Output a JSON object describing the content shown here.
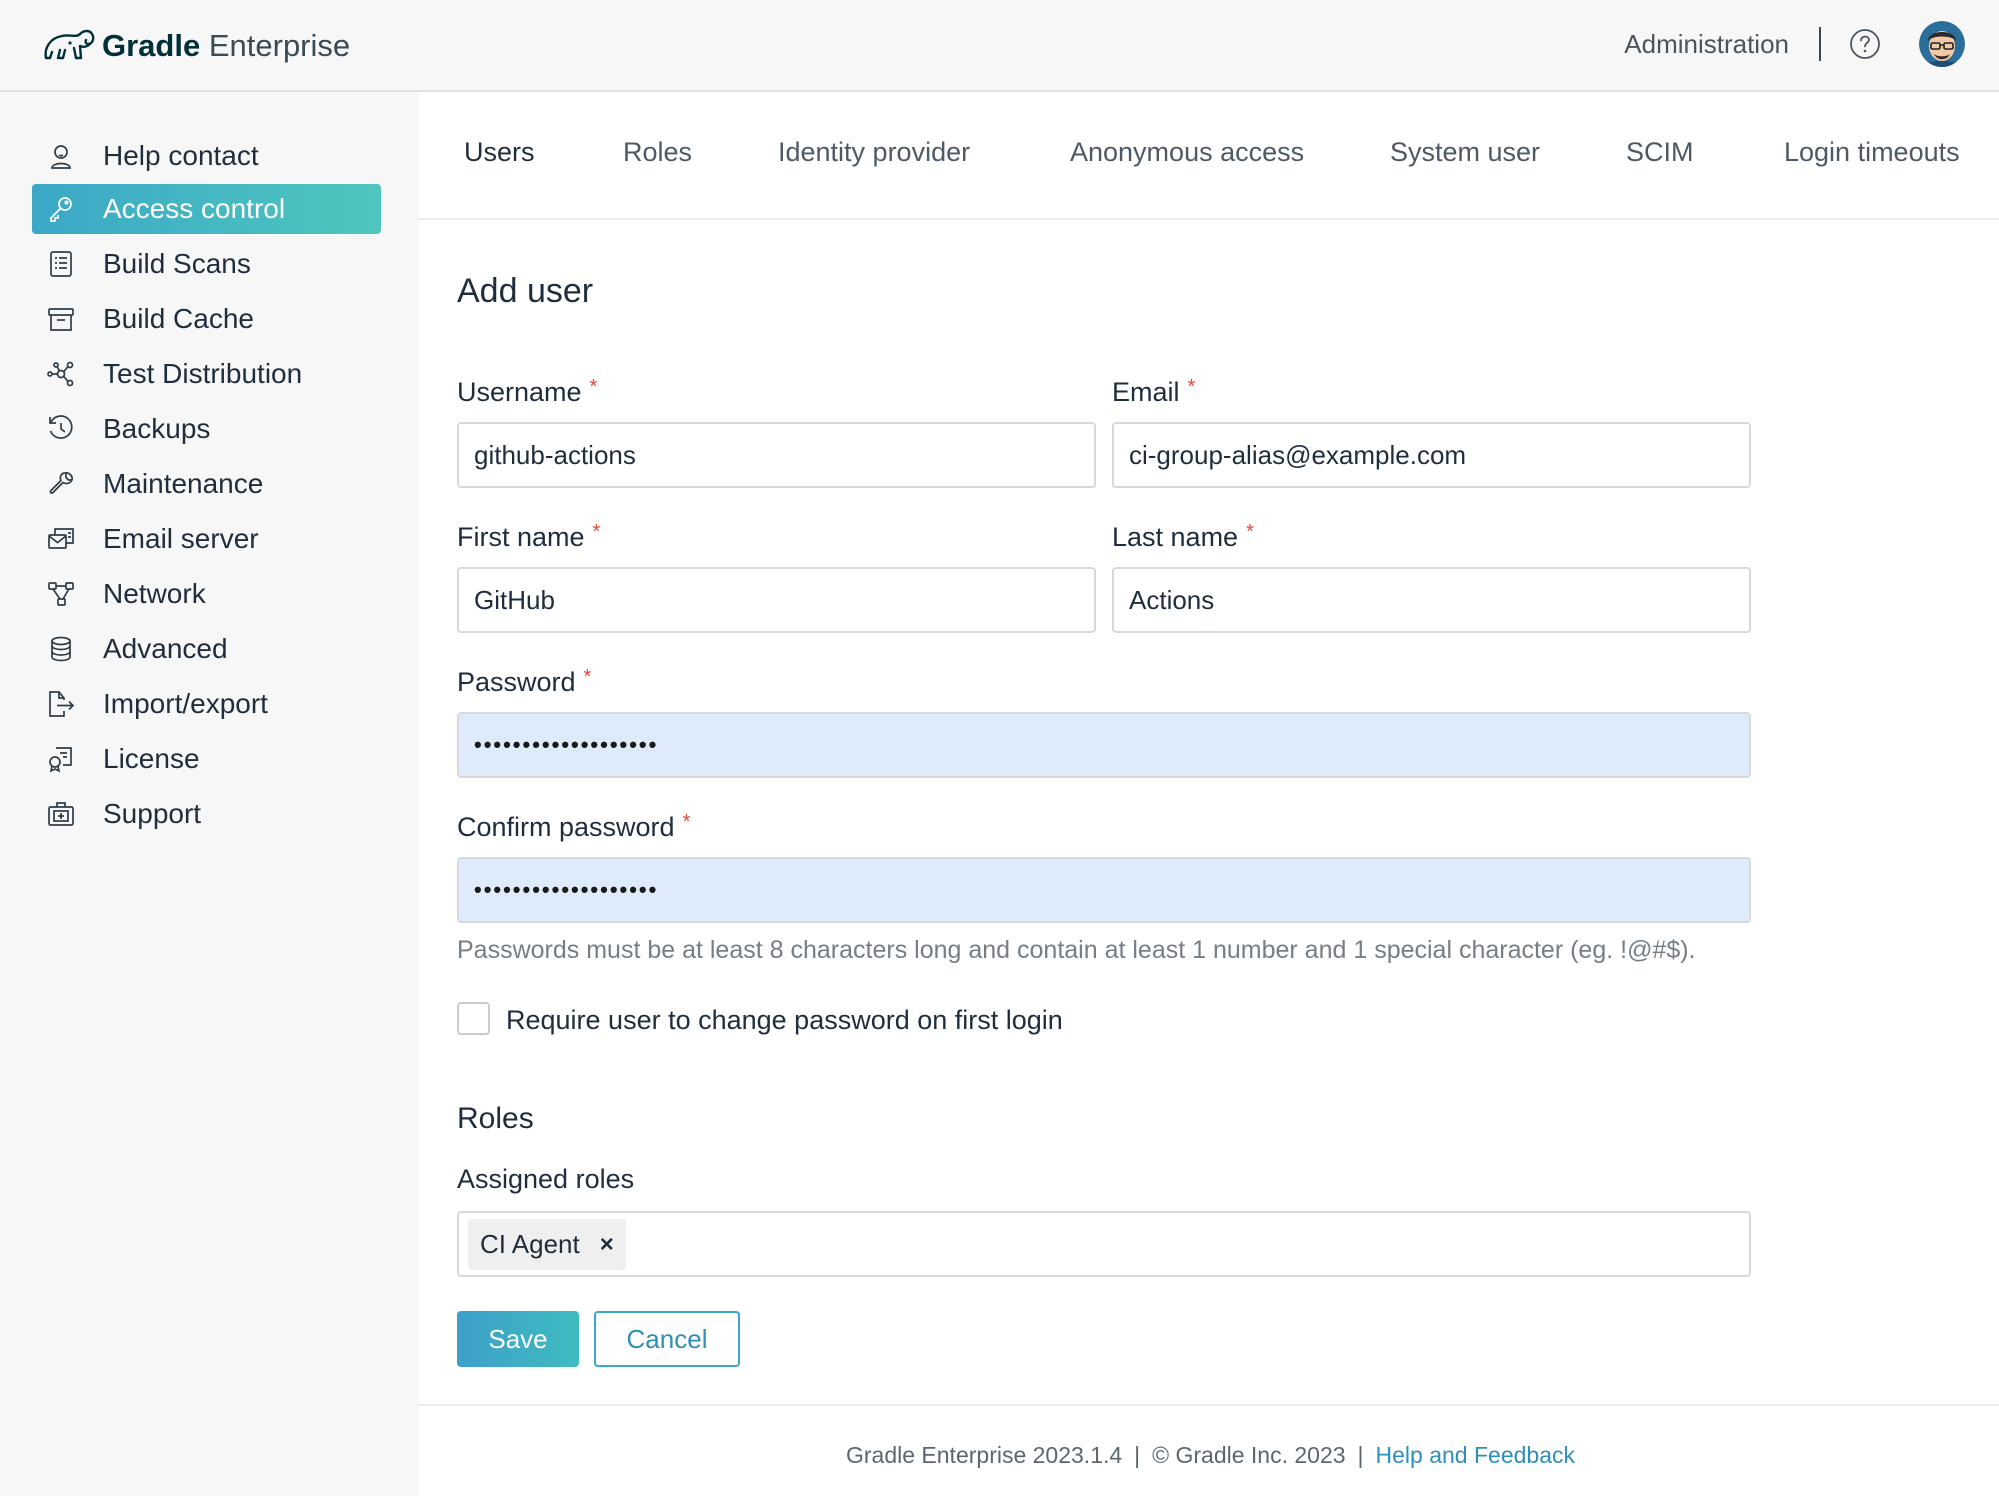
{
  "header": {
    "brand_bold": "Gradle",
    "brand_light": "Enterprise",
    "admin_label": "Administration",
    "help_icon": "question-circle-icon"
  },
  "sidebar": {
    "items": [
      {
        "label": "Help contact",
        "icon": "person-icon"
      },
      {
        "label": "Access control",
        "icon": "key-icon",
        "active": true
      },
      {
        "label": "Build Scans",
        "icon": "list-icon"
      },
      {
        "label": "Build Cache",
        "icon": "archive-icon"
      },
      {
        "label": "Test Distribution",
        "icon": "distribution-icon"
      },
      {
        "label": "Backups",
        "icon": "history-icon"
      },
      {
        "label": "Maintenance",
        "icon": "wrench-icon"
      },
      {
        "label": "Email server",
        "icon": "email-server-icon"
      },
      {
        "label": "Network",
        "icon": "network-icon"
      },
      {
        "label": "Advanced",
        "icon": "database-icon"
      },
      {
        "label": "Import/export",
        "icon": "export-icon"
      },
      {
        "label": "License",
        "icon": "license-icon"
      },
      {
        "label": "Support",
        "icon": "support-icon"
      }
    ]
  },
  "tabs": [
    {
      "label": "Users",
      "active": true
    },
    {
      "label": "Roles"
    },
    {
      "label": "Identity provider"
    },
    {
      "label": "Anonymous access"
    },
    {
      "label": "System user"
    },
    {
      "label": "SCIM"
    },
    {
      "label": "Login timeouts"
    }
  ],
  "form": {
    "title": "Add user",
    "username": {
      "label": "Username",
      "value": "github-actions"
    },
    "email": {
      "label": "Email",
      "value": "ci-group-alias@example.com"
    },
    "first_name": {
      "label": "First name",
      "value": "GitHub"
    },
    "last_name": {
      "label": "Last name",
      "value": "Actions"
    },
    "password": {
      "label": "Password",
      "masked": "•••••••••••••••••••"
    },
    "confirm_password": {
      "label": "Confirm password",
      "masked": "•••••••••••••••••••"
    },
    "password_hint": "Passwords must be at least 8 characters long and contain at least 1 number and 1 special character (eg. !@#$).",
    "require_change_label": "Require user to change password on first login",
    "require_change_checked": false,
    "required_marker": "*"
  },
  "roles": {
    "section_title": "Roles",
    "assigned_label": "Assigned roles",
    "assigned": [
      "CI Agent"
    ],
    "remove_glyph": "×"
  },
  "actions": {
    "save_label": "Save",
    "cancel_label": "Cancel"
  },
  "footer": {
    "version": "Gradle Enterprise 2023.1.4",
    "copyright": "© Gradle Inc. 2023",
    "help_link": "Help and Feedback",
    "separator": "|"
  }
}
